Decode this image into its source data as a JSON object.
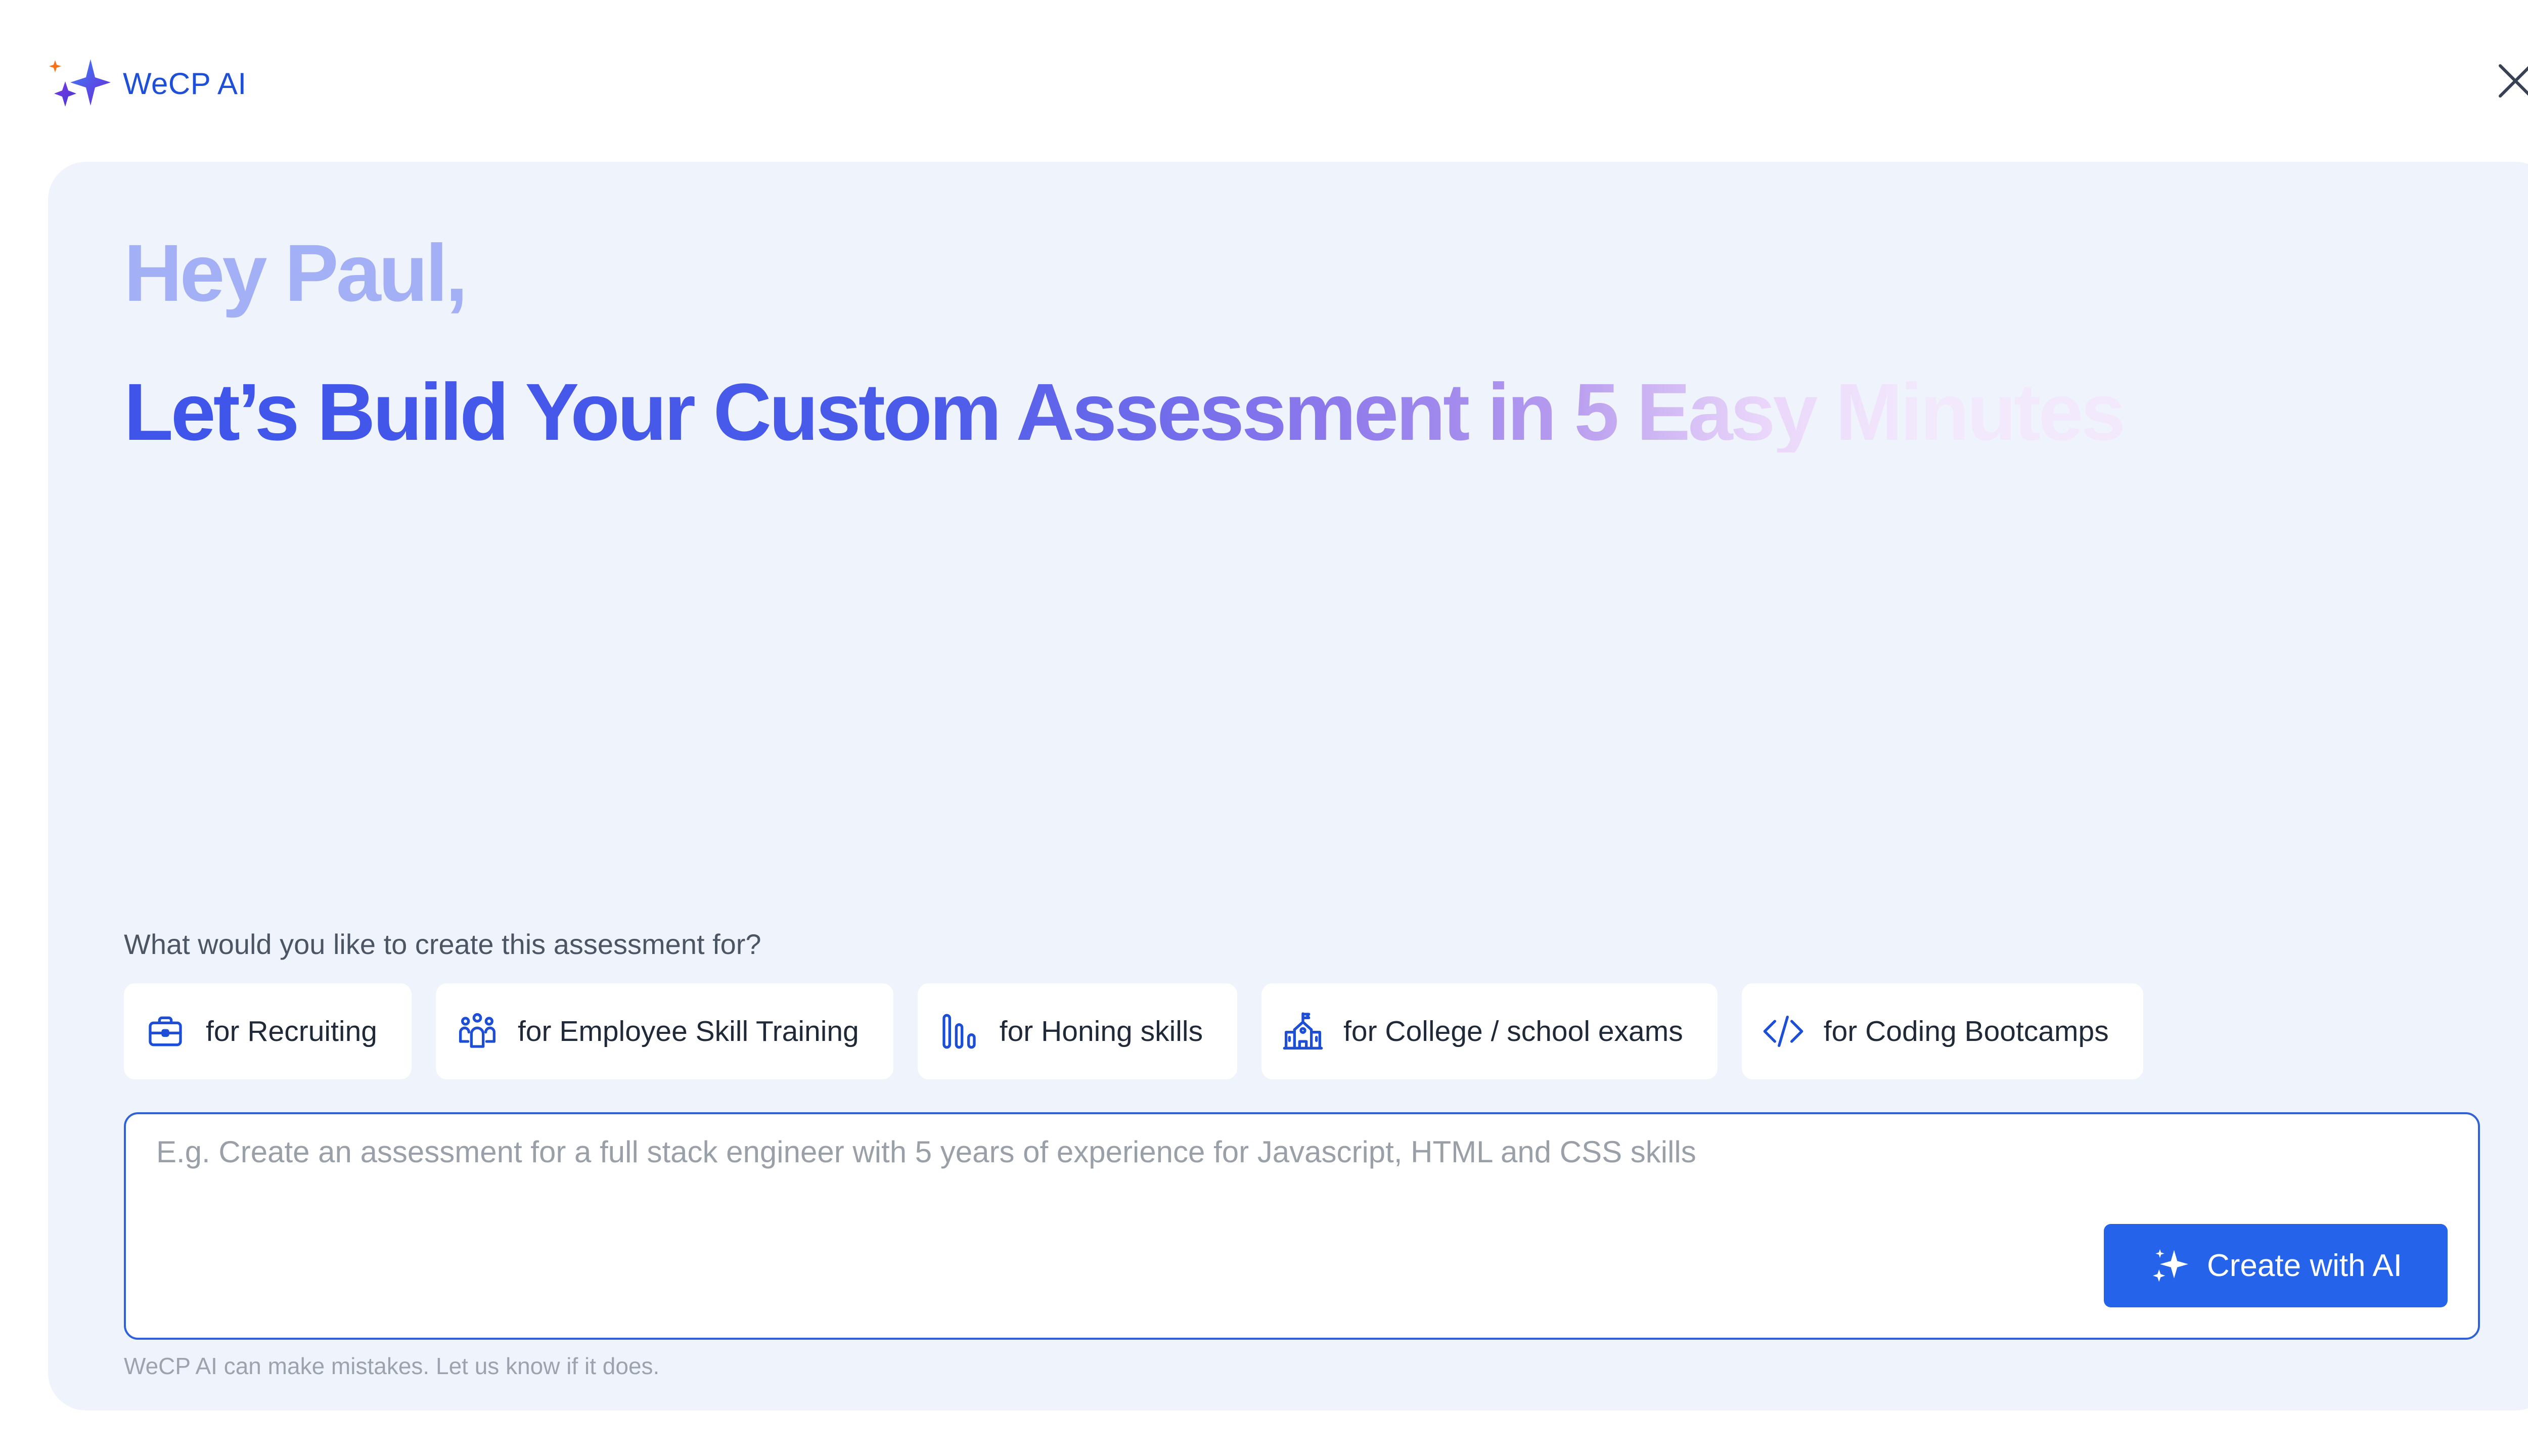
{
  "header": {
    "brand_name": "WeCP AI",
    "close_icon": "close-icon"
  },
  "hero": {
    "greeting": "Hey Paul,",
    "headline": "Let’s Build Your Custom Assessment in 5 Easy Minutes"
  },
  "purpose": {
    "question": "What would you like to create this assessment for?",
    "options": [
      {
        "label": "for Recruiting",
        "icon": "briefcase-icon"
      },
      {
        "label": "for Employee Skill Training",
        "icon": "team-icon"
      },
      {
        "label": "for Honing skills",
        "icon": "bars-icon"
      },
      {
        "label": "for College / school exams",
        "icon": "school-icon"
      },
      {
        "label": "for Coding Bootcamps",
        "icon": "code-icon"
      }
    ]
  },
  "prompt": {
    "placeholder": "E.g. Create an assessment for a full stack engineer with 5 years of experience for Javascript, HTML and CSS skills",
    "value": "",
    "submit_label": "Create with AI",
    "submit_icon": "sparkle-icon"
  },
  "disclaimer": "WeCP AI can make mistakes. Let us know if it does.",
  "colors": {
    "accent": "#2563eb",
    "brand_text": "#1d4fd8",
    "panel_bg": "#eff4fc",
    "greeting": "#a4b0f6",
    "headline_start": "#3f55ea",
    "headline_end": "#f2e9fc"
  }
}
